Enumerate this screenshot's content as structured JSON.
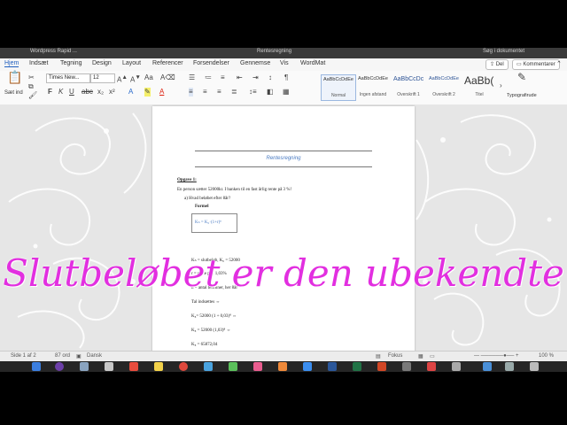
{
  "window": {
    "title_left": "Wordpress Rapid ...",
    "title": "Rentesregning",
    "search_placeholder": "Søg i dokumentet"
  },
  "ribbon_tabs": [
    "Hjem",
    "Indsæt",
    "Tegning",
    "Design",
    "Layout",
    "Referencer",
    "Forsendelser",
    "Gennemse",
    "Vis",
    "WordMat"
  ],
  "share_button": "Del",
  "comments_button": "Kommentarer",
  "paste_label": "Sæt ind",
  "font": {
    "family": "Times New...",
    "size": "12"
  },
  "styles": [
    {
      "sample": "AaBbCcDdEe",
      "name": "Normal"
    },
    {
      "sample": "AaBbCcDdEe",
      "name": "Ingen afstand"
    },
    {
      "sample": "AaBbCcDc",
      "name": "Overskrift 1"
    },
    {
      "sample": "AaBbCcDdEe",
      "name": "Overskrift 2"
    },
    {
      "sample": "AaBb(",
      "name": "Titel"
    }
  ],
  "typography_pane": "Typografirude",
  "document": {
    "heading": "Rentesregning",
    "task": "Opgave 1:",
    "problem": "En person sætter 52000kr. I banken til en fast årlig rente på 3 %!",
    "question": "a)   Hvad beløbet efter 8år?",
    "formula_label": "Formel",
    "formula": "Kₙ = K₀·(1+r)ⁿ",
    "lines": [
      "Kₙ = slutbeløb, K₀ = 52000",
      "r = rente p.a. 1,03%",
      "n = antal terminer, her 8år",
      "Tal indsættes ⇔",
      "K₈= 52000 (1 + 0,03)⁸ ⇔",
      "K₈ = 52000 (1,03)⁸ ⇔",
      "K₈ = 65872,04"
    ]
  },
  "overlay_text": "Slutbeløbet er den ubekendte",
  "status": {
    "page": "Side 1 af 2",
    "words": "87 ord",
    "language": "Dansk",
    "focus": "Fokus",
    "zoom": "100 %"
  },
  "colors": {
    "overlay": "#e22fe0",
    "accent": "#1f5fbf",
    "heading": "#4a7bc2"
  }
}
